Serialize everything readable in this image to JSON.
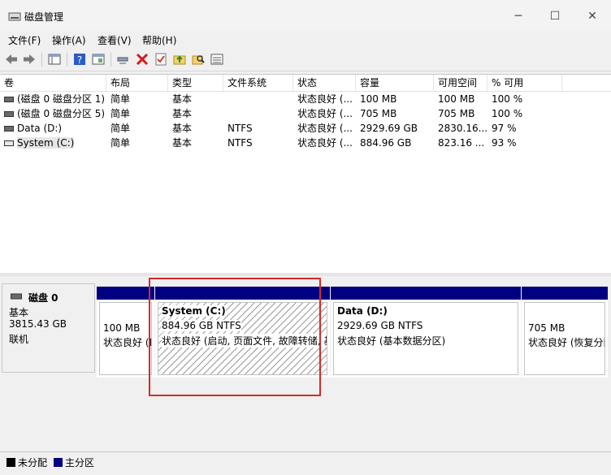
{
  "window": {
    "title": "磁盘管理",
    "minimize": "─",
    "maximize": "☐",
    "close": "✕"
  },
  "menu": [
    "文件(F)",
    "操作(A)",
    "查看(V)",
    "帮助(H)"
  ],
  "columns": [
    "卷",
    "布局",
    "类型",
    "文件系统",
    "状态",
    "容量",
    "可用空间",
    "% 可用"
  ],
  "volumes": [
    {
      "name": "(磁盘 0 磁盘分区 1)",
      "layout": "简单",
      "type": "基本",
      "fs": "",
      "status": "状态良好 (...",
      "capacity": "100 MB",
      "free": "100 MB",
      "pct": "100 %"
    },
    {
      "name": "(磁盘 0 磁盘分区 5)",
      "layout": "简单",
      "type": "基本",
      "fs": "",
      "status": "状态良好 (...",
      "capacity": "705 MB",
      "free": "705 MB",
      "pct": "100 %"
    },
    {
      "name": "Data (D:)",
      "layout": "简单",
      "type": "基本",
      "fs": "NTFS",
      "status": "状态良好 (...",
      "capacity": "2929.69 GB",
      "free": "2830.16...",
      "pct": "97 %"
    },
    {
      "name": "System (C:)",
      "layout": "简单",
      "type": "基本",
      "fs": "NTFS",
      "status": "状态良好 (...",
      "capacity": "884.96 GB",
      "free": "823.16 ...",
      "pct": "93 %"
    }
  ],
  "disk": {
    "name": "磁盘 0",
    "type": "基本",
    "size": "3815.43 GB",
    "state": "联机"
  },
  "partitions": [
    {
      "title": "",
      "size": "100 MB",
      "status": "状态良好 (EFI 系统分区)"
    },
    {
      "title": "System  (C:)",
      "size": "884.96 GB NTFS",
      "status": "状态良好 (启动, 页面文件, 故障转储, 基本数据分区)"
    },
    {
      "title": "Data  (D:)",
      "size": "2929.69 GB NTFS",
      "status": "状态良好 (基本数据分区)"
    },
    {
      "title": "",
      "size": "705 MB",
      "status": "状态良好 (恢复分区)"
    }
  ],
  "legend": [
    {
      "label": "未分配",
      "color": "#000000"
    },
    {
      "label": "主分区",
      "color": "#000080"
    }
  ],
  "colors": {
    "primary_bar": "#000080",
    "highlight": "#d42a2a"
  },
  "icons": [
    "back-icon",
    "forward-icon",
    "console-tree-icon",
    "help-icon",
    "properties-icon",
    "connect-icon",
    "delete-icon",
    "check-icon",
    "up-folder-icon",
    "search-folder-icon",
    "list-icon"
  ]
}
